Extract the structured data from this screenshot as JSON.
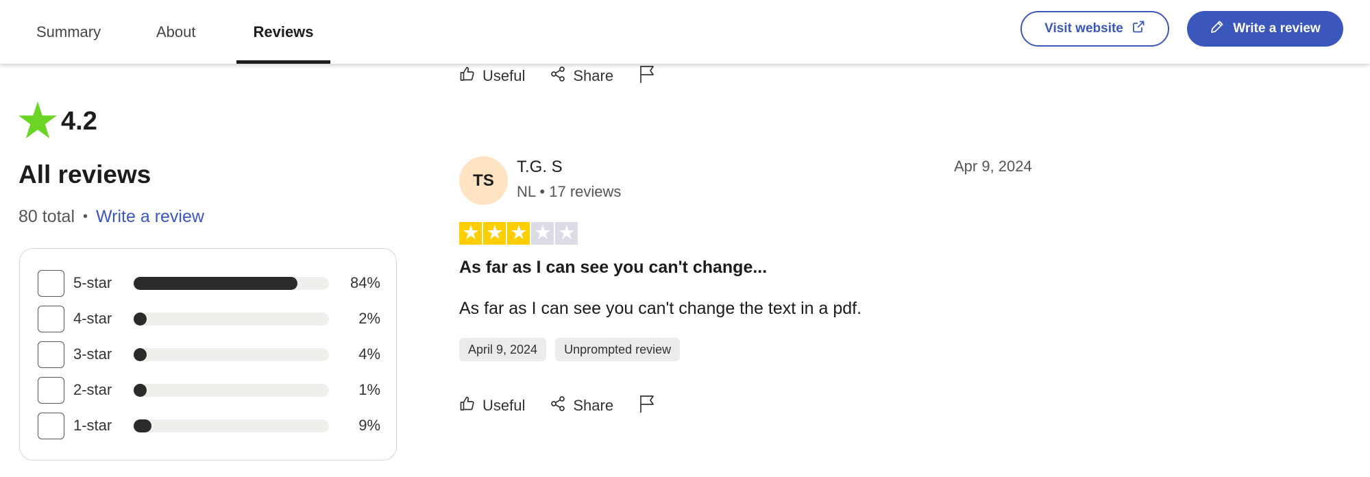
{
  "tabs": [
    {
      "label": "Summary"
    },
    {
      "label": "About"
    },
    {
      "label": "Reviews",
      "active": true
    }
  ],
  "header": {
    "visit_website_label": "Visit website",
    "write_review_label": "Write a review",
    "accent_color": "#3c57bc"
  },
  "actions": {
    "useful_label": "Useful",
    "share_label": "Share"
  },
  "summary": {
    "rating": "4.2",
    "title": "All reviews",
    "total": "80 total",
    "separator": "•",
    "write_review_link": "Write a review",
    "distribution": [
      {
        "label": "5-star",
        "percent": "84%",
        "value": 84
      },
      {
        "label": "4-star",
        "percent": "2%",
        "value": 2
      },
      {
        "label": "3-star",
        "percent": "4%",
        "value": 4
      },
      {
        "label": "2-star",
        "percent": "1%",
        "value": 1
      },
      {
        "label": "1-star",
        "percent": "9%",
        "value": 9
      }
    ]
  },
  "review": {
    "initials": "TS",
    "name": "T.G. S",
    "meta": "NL • 17 reviews",
    "date": "Apr 9, 2024",
    "stars": 3,
    "max_stars": 5,
    "title": "As far as I can see you can't change...",
    "body": "As far as I can see you can't change the text in a pdf.",
    "tags": [
      "April 9, 2024",
      "Unprompted review"
    ]
  }
}
